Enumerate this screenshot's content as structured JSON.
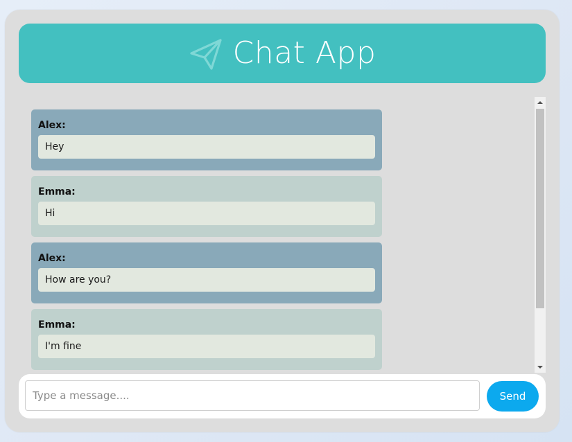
{
  "header": {
    "title": "Chat App",
    "icon": "paper-plane-icon",
    "color": "#43c0c0"
  },
  "messages": [
    {
      "sender": "Alex:",
      "text": "Hey",
      "color": "#89a9b9"
    },
    {
      "sender": "Emma:",
      "text": "Hi",
      "color": "#bfd1cd"
    },
    {
      "sender": "Alex:",
      "text": "How are you?",
      "color": "#89a9b9"
    },
    {
      "sender": "Emma:",
      "text": "I'm fine",
      "color": "#bfd1cd"
    }
  ],
  "composer": {
    "placeholder": "Type a message....",
    "value": "",
    "send_label": "Send",
    "send_color": "#0ca9ee"
  }
}
